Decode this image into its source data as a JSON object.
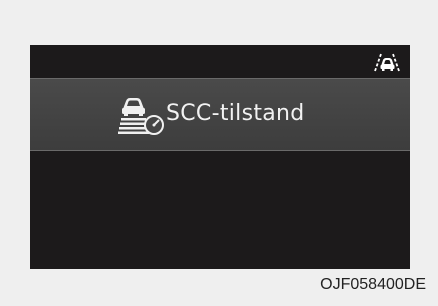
{
  "display": {
    "menu_item_label": "SCC-tilstand",
    "icons": {
      "top_right": "lane-vehicle-icon",
      "menu_item": "smart-cruise-control-icon"
    }
  },
  "caption": "OJF058400DE",
  "colors": {
    "screen_bg": "#1c1a1b",
    "highlight_bg": "#454545",
    "text": "#f2f2f2",
    "page_bg": "#efefef"
  }
}
